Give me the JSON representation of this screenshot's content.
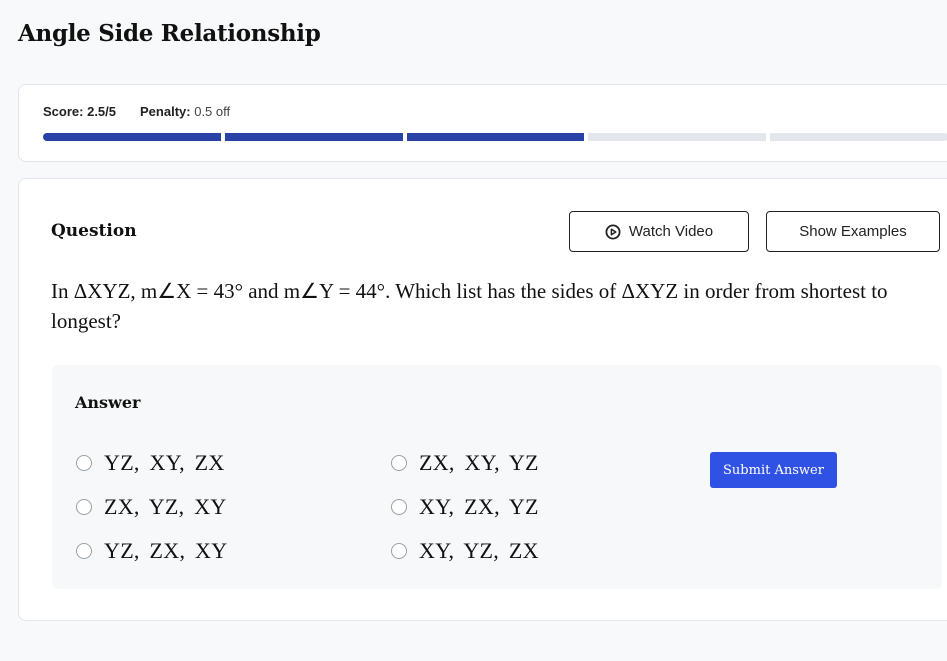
{
  "page": {
    "title": "Angle Side Relationship"
  },
  "score": {
    "score_label": "Score:",
    "score_value": "2.5/5",
    "penalty_label": "Penalty:",
    "penalty_value": "0.5 off",
    "progress": {
      "filled_segments": 3,
      "total_segments": 5,
      "fill_color": "#2a42a8",
      "empty_color": "#e3e6ed"
    }
  },
  "question": {
    "heading": "Question",
    "watch_video_label": "Watch Video",
    "show_examples_label": "Show Examples",
    "text": "In ΔXYZ, m∠X = 43° and m∠Y = 44°. Which list has the sides of ΔXYZ in order from shortest to longest?"
  },
  "answer": {
    "heading": "Answer",
    "options": [
      {
        "label": "YZ, XY, ZX",
        "selected": false
      },
      {
        "label": "ZX, XY, YZ",
        "selected": false
      },
      {
        "label": "ZX, YZ, XY",
        "selected": false
      },
      {
        "label": "XY, ZX, YZ",
        "selected": false
      },
      {
        "label": "YZ, ZX, XY",
        "selected": false
      },
      {
        "label": "XY, YZ, ZX",
        "selected": false
      }
    ],
    "submit_label": "Submit Answer",
    "submit_color": "#3052e4"
  }
}
